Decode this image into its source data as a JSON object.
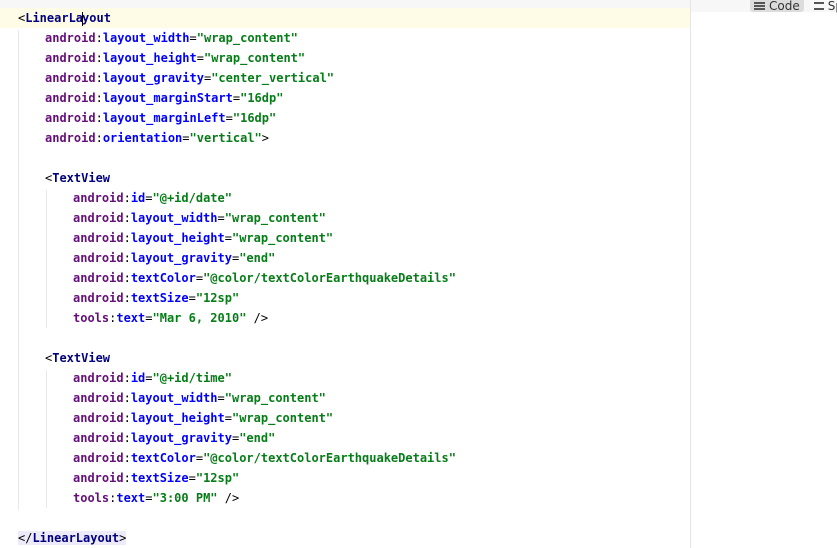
{
  "view_modes": [
    {
      "label": "Code",
      "icon": "code-view-icon",
      "selected": true
    },
    {
      "label": "Split",
      "icon": "split-view-icon",
      "selected": false
    }
  ],
  "code": {
    "open_tag": "LinearLayout",
    "root_attrs": [
      {
        "ns": "android",
        "name": "layout_width",
        "value": "\"wrap_content\""
      },
      {
        "ns": "android",
        "name": "layout_height",
        "value": "\"wrap_content\""
      },
      {
        "ns": "android",
        "name": "layout_gravity",
        "value": "\"center_vertical\""
      },
      {
        "ns": "android",
        "name": "layout_marginStart",
        "value": "\"16dp\""
      },
      {
        "ns": "android",
        "name": "layout_marginLeft",
        "value": "\"16dp\""
      },
      {
        "ns": "android",
        "name": "orientation",
        "value": "\"vertical\"",
        "suffix": ">"
      }
    ],
    "children": [
      {
        "tag": "TextView",
        "attrs": [
          {
            "ns": "android",
            "name": "id",
            "value": "\"@+id/date\""
          },
          {
            "ns": "android",
            "name": "layout_width",
            "value": "\"wrap_content\""
          },
          {
            "ns": "android",
            "name": "layout_height",
            "value": "\"wrap_content\""
          },
          {
            "ns": "android",
            "name": "layout_gravity",
            "value": "\"end\""
          },
          {
            "ns": "android",
            "name": "textColor",
            "value": "\"@color/textColorEarthquakeDetails\""
          },
          {
            "ns": "android",
            "name": "textSize",
            "value": "\"12sp\""
          },
          {
            "ns": "tools",
            "name": "text",
            "value": "\"Mar 6, 2010\"",
            "suffix": " />"
          }
        ]
      },
      {
        "tag": "TextView",
        "attrs": [
          {
            "ns": "android",
            "name": "id",
            "value": "\"@+id/time\""
          },
          {
            "ns": "android",
            "name": "layout_width",
            "value": "\"wrap_content\""
          },
          {
            "ns": "android",
            "name": "layout_height",
            "value": "\"wrap_content\""
          },
          {
            "ns": "android",
            "name": "layout_gravity",
            "value": "\"end\""
          },
          {
            "ns": "android",
            "name": "textColor",
            "value": "\"@color/textColorEarthquakeDetails\""
          },
          {
            "ns": "android",
            "name": "textSize",
            "value": "\"12sp\""
          },
          {
            "ns": "tools",
            "name": "text",
            "value": "\"3:00 PM\"",
            "suffix": " />"
          }
        ]
      }
    ],
    "close_tag": "LinearLayout"
  },
  "colors": {
    "tag": "#000080",
    "namespace": "#660e7a",
    "attribute": "#0000ff",
    "value": "#067d17",
    "current_line": "#fefbe7",
    "tag_highlight": "#edeaf9"
  }
}
